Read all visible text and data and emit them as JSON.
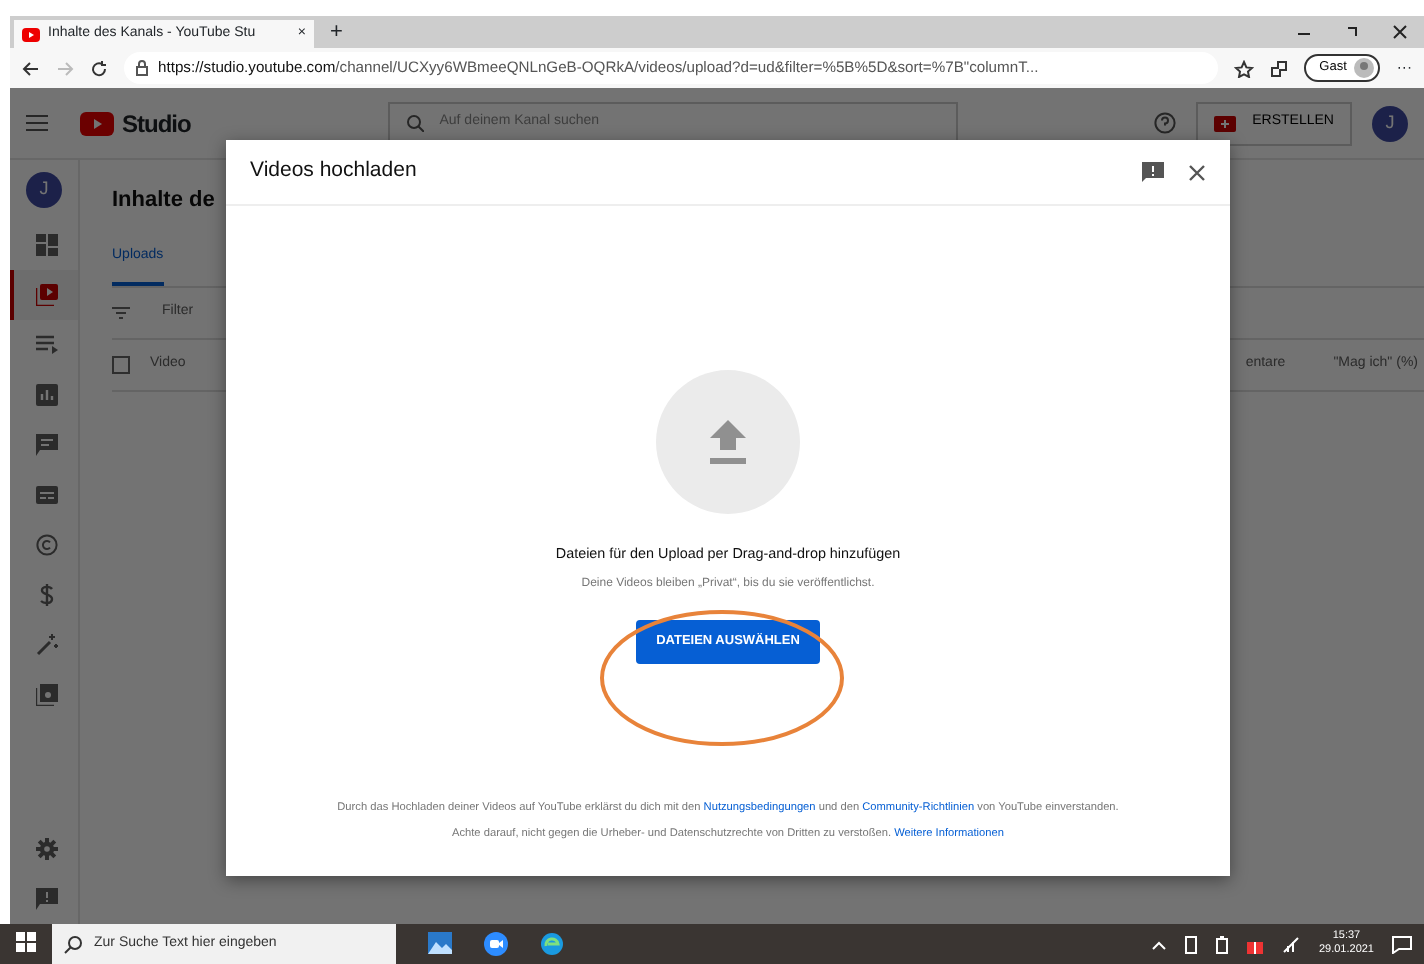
{
  "browser": {
    "tab": {
      "title": "Inhalte des Kanals - YouTube Stu",
      "close": "×"
    },
    "new_tab": "+",
    "url_host": "https://studio.youtube.com",
    "url_path": "/channel/UCXyy6WBmeeQNLnGeB-OQRkA/videos/upload?d=ud&filter=%5B%5D&sort=%7B\"columnT...",
    "profile": "Gast",
    "more": "···"
  },
  "studio": {
    "logo": "Studio",
    "search": {
      "placeholder": "Auf deinem Kanal suchen"
    },
    "create": "ERSTELLEN",
    "avatar": "J",
    "sidebar": {
      "avatar": "J",
      "items": [
        {
          "kind": "dashboard",
          "selected": false
        },
        {
          "kind": "content",
          "selected": true
        },
        {
          "kind": "playlists",
          "selected": false
        },
        {
          "kind": "analytics",
          "selected": false
        },
        {
          "kind": "comments",
          "selected": false
        },
        {
          "kind": "subtitles",
          "selected": false
        },
        {
          "kind": "copyright",
          "selected": false
        },
        {
          "kind": "money",
          "selected": false
        },
        {
          "kind": "customize",
          "selected": false
        },
        {
          "kind": "library",
          "selected": false
        }
      ],
      "bottom": [
        {
          "kind": "settings",
          "selected": false
        },
        {
          "kind": "feedback",
          "selected": false
        }
      ]
    },
    "page_title": "Inhalte de",
    "tabs": [
      {
        "label": "Uploads",
        "selected": true
      }
    ],
    "filter": "Filter",
    "select_all": {
      "checked": false
    },
    "columns": [
      "Video",
      "entare",
      "\"Mag ich\" (%)"
    ]
  },
  "modal": {
    "title": "Videos hochladen",
    "headline": "Dateien für den Upload per Drag-and-drop hinzufügen",
    "subline": "Deine Videos bleiben „Privat“, bis du sie veröffentlichst.",
    "button": "DATEIEN AUSWÄHLEN",
    "footer": [
      [
        {
          "text": "Durch das Hochladen deiner Videos auf YouTube erklärst du dich mit den ",
          "link": false
        },
        {
          "text": "Nutzungsbedingungen",
          "link": true
        },
        {
          "text": " und den ",
          "link": false
        },
        {
          "text": "Community-Richtlinien",
          "link": true
        },
        {
          "text": " von YouTube einverstanden.",
          "link": false
        }
      ],
      [
        {
          "text": "Achte darauf, nicht gegen die Urheber- und Datenschutzrechte von Dritten zu verstoßen. ",
          "link": false
        },
        {
          "text": "Weitere Informationen",
          "link": true
        }
      ]
    ]
  },
  "taskbar": {
    "search": {
      "placeholder": "Zur Suche Text hier eingeben"
    },
    "time": "15:37",
    "date": "29.01.2021"
  }
}
